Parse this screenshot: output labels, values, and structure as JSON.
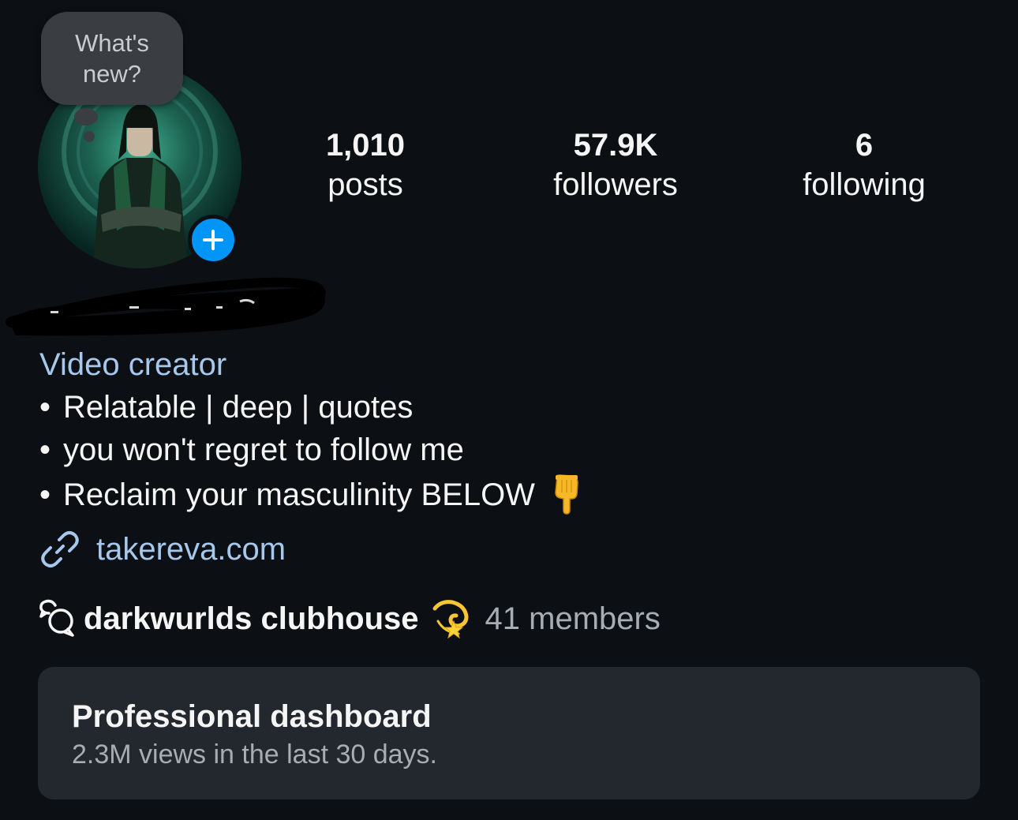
{
  "profile": {
    "note_text": "What's new?",
    "stats": {
      "posts": {
        "value": "1,010",
        "label": "posts"
      },
      "followers": {
        "value": "57.9K",
        "label": "followers"
      },
      "following": {
        "value": "6",
        "label": "following"
      }
    },
    "category": "Video creator",
    "bio": {
      "line1": "Relatable | deep | quotes",
      "line2": "you won't regret to follow me",
      "line3": "Reclaim your masculinity BELOW",
      "bullet": "•"
    },
    "link": "takereva.com",
    "channel": {
      "name": "darkwurlds clubhouse",
      "members": "41 members"
    },
    "dashboard": {
      "title": "Professional dashboard",
      "subtitle": "2.3M views in the last 30 days."
    }
  },
  "icons": {
    "add": "plus-icon",
    "link": "link-icon",
    "chat": "chat-bubbles-icon",
    "channel_emoji": "dizzy-emoji",
    "bio_emoji": "pointing-down-emoji"
  },
  "colors": {
    "background": "#0c1014",
    "accent_blue": "#0095f6",
    "link_blue": "#a5c8ec",
    "card": "#23272e",
    "muted_text": "#a8adb3"
  }
}
